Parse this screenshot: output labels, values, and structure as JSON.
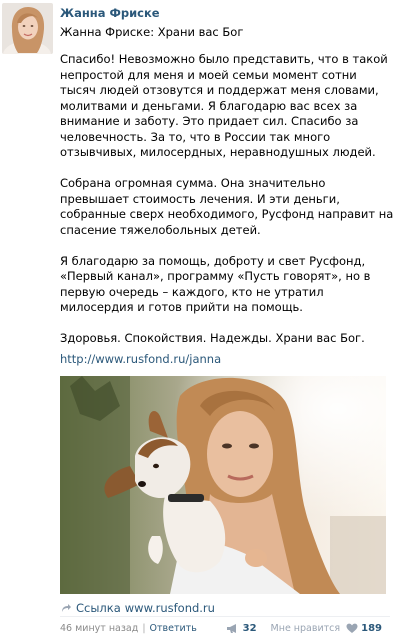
{
  "author": {
    "name": "Жанна Фриске"
  },
  "post": {
    "title": "Жанна Фриске: Храни вас Бог",
    "paragraphs": [
      "Спасибо! Невозможно было представить, что в такой непростой для меня и моей семьи момент сотни тысяч людей отзовутся и поддержат меня словами, молитвами и деньгами. Я благодарю вас всех за внимание и заботу. Это придает сил. Спасибо за человечность. За то, что в России так много отзывчивых, милосердных, неравнодушных людей.",
      "Собрана огромная сумма. Она значительно превышает стоимость лечения. И эти деньги, собранные сверх необходимого, Русфонд направит на спасение тяжелобольных детей.",
      "Я благодарю за помощь, доброту и свет Русфонд, «Первый канал», программу «Пусть говорят», но в первую очередь – каждого, кто не утратил милосердия и готов прийти на помощь.",
      "Здоровья. Спокойствия. Надежды. Храни вас Бог."
    ],
    "link": "http://www.rusfond.ru/janna"
  },
  "attachment": {
    "label": "Ссылка",
    "url": "www.rusfond.ru"
  },
  "footer": {
    "time": "46 минут назад",
    "separator": "|",
    "reply": "Ответить",
    "share_count": "32",
    "like_label": "Мне нравится",
    "like_count": "189"
  },
  "icons": {
    "share": "share-arrow-icon",
    "megaphone": "megaphone-icon",
    "heart": "heart-icon"
  },
  "colors": {
    "link": "#2b587a",
    "muted": "#999999"
  }
}
